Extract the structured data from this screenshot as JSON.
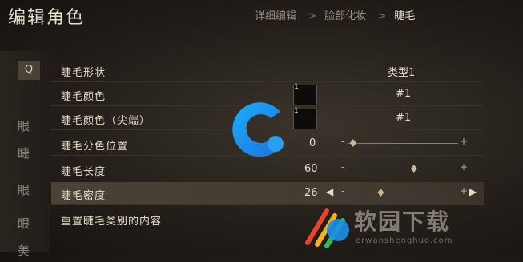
{
  "header": {
    "title": "编辑角色",
    "breadcrumb": [
      "详细编辑",
      "脸部化妆",
      "睫毛"
    ],
    "separator": ">"
  },
  "left_panel": {
    "q_label": "Q",
    "tabs": [
      "眼",
      "睫",
      "眼",
      "眼",
      "美"
    ]
  },
  "rows": [
    {
      "label": "睫毛形状",
      "value": "类型1"
    },
    {
      "label": "睫毛颜色",
      "swatch_num": "1",
      "value": "#1"
    },
    {
      "label": "睫毛颜色（尖端）",
      "swatch_num": "1",
      "value": "#1"
    },
    {
      "label": "睫毛分色位置",
      "value": "0",
      "slider": {
        "min_label": "-",
        "max_label": "+",
        "level": 0.05
      }
    },
    {
      "label": "睫毛长度",
      "value": "60",
      "slider": {
        "min_label": "-",
        "max_label": "+",
        "level": 0.6
      }
    },
    {
      "label": "睫毛密度",
      "value": "26",
      "slider": {
        "min_label": "-",
        "max_label": "+",
        "level": 0.3
      }
    },
    {
      "label": "重置睫毛类别的内容"
    }
  ],
  "arrows": {
    "left": "◀",
    "right": "▶"
  },
  "watermark": {
    "text": "软园下载",
    "sub": "erwanshenghuo.com"
  },
  "colors": {
    "accent": "#c9b991",
    "logo_blue": "#1e8fe6"
  },
  "icons": [
    "logo-c-icon",
    "watermark-logo-icon"
  ]
}
